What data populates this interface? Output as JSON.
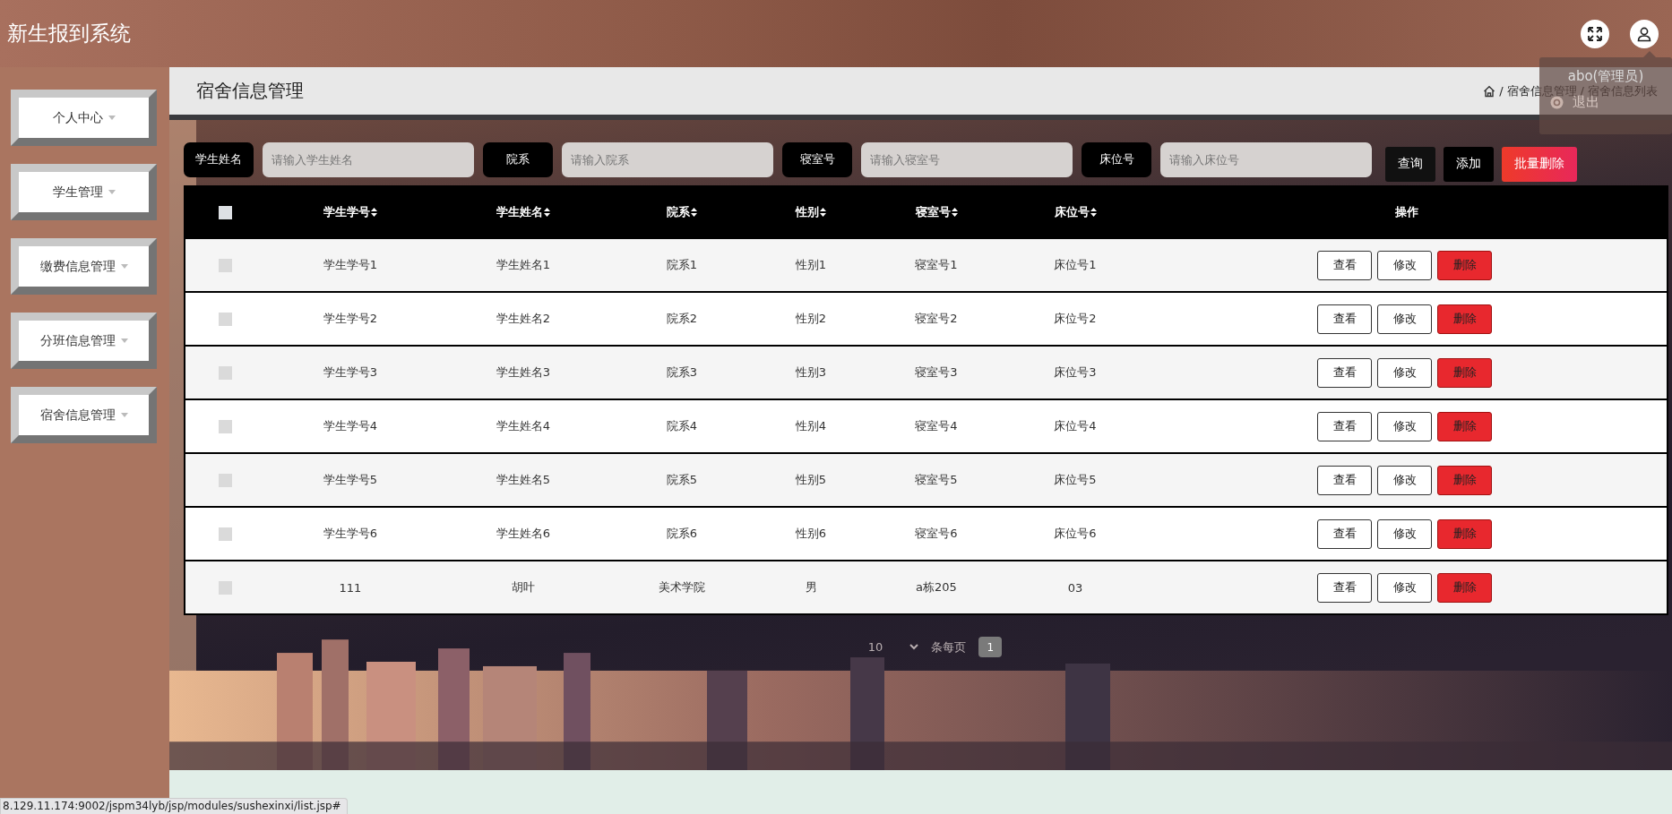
{
  "app": {
    "title": "新生报到系统"
  },
  "user_menu": {
    "user": "abo(管理员)",
    "logout": "退出"
  },
  "sidebar": {
    "items": [
      {
        "label": "个人中心"
      },
      {
        "label": "学生管理"
      },
      {
        "label": "缴费信息管理"
      },
      {
        "label": "分班信息管理"
      },
      {
        "label": "宿舍信息管理"
      }
    ]
  },
  "page": {
    "title": "宿舍信息管理",
    "breadcrumb_separator": "/",
    "breadcrumb": [
      "宿舍信息管理",
      "宿舍信息列表"
    ]
  },
  "search": {
    "fields": [
      {
        "label": "学生姓名",
        "placeholder": "请输入学生姓名"
      },
      {
        "label": "院系",
        "placeholder": "请输入院系"
      },
      {
        "label": "寝室号",
        "placeholder": "请输入寝室号"
      },
      {
        "label": "床位号",
        "placeholder": "请输入床位号"
      }
    ],
    "buttons": [
      {
        "label": "查询",
        "kind": "query"
      },
      {
        "label": "添加",
        "kind": "add"
      },
      {
        "label": "批量删除",
        "kind": "danger"
      }
    ]
  },
  "table": {
    "all_checked": false,
    "columns": [
      {
        "label": "学生学号",
        "sortable": true
      },
      {
        "label": "学生姓名",
        "sortable": true
      },
      {
        "label": "院系",
        "sortable": true
      },
      {
        "label": "性别",
        "sortable": true
      },
      {
        "label": "寝室号",
        "sortable": true
      },
      {
        "label": "床位号",
        "sortable": true
      },
      {
        "label": "操作",
        "sortable": false
      }
    ],
    "rows": [
      {
        "checked": false,
        "cells": [
          "学生学号1",
          "学生姓名1",
          "院系1",
          "性别1",
          "寝室号1",
          "床位号1"
        ],
        "actions": [
          {
            "label": "查看",
            "kind": "plain"
          },
          {
            "label": "修改",
            "kind": "plain"
          },
          {
            "label": "删除",
            "kind": "danger"
          }
        ]
      },
      {
        "checked": false,
        "cells": [
          "学生学号2",
          "学生姓名2",
          "院系2",
          "性别2",
          "寝室号2",
          "床位号2"
        ],
        "actions": [
          {
            "label": "查看",
            "kind": "plain"
          },
          {
            "label": "修改",
            "kind": "plain"
          },
          {
            "label": "删除",
            "kind": "danger"
          }
        ]
      },
      {
        "checked": false,
        "cells": [
          "学生学号3",
          "学生姓名3",
          "院系3",
          "性别3",
          "寝室号3",
          "床位号3"
        ],
        "actions": [
          {
            "label": "查看",
            "kind": "plain"
          },
          {
            "label": "修改",
            "kind": "plain"
          },
          {
            "label": "删除",
            "kind": "danger"
          }
        ]
      },
      {
        "checked": false,
        "cells": [
          "学生学号4",
          "学生姓名4",
          "院系4",
          "性别4",
          "寝室号4",
          "床位号4"
        ],
        "actions": [
          {
            "label": "查看",
            "kind": "plain"
          },
          {
            "label": "修改",
            "kind": "plain"
          },
          {
            "label": "删除",
            "kind": "danger"
          }
        ]
      },
      {
        "checked": false,
        "cells": [
          "学生学号5",
          "学生姓名5",
          "院系5",
          "性别5",
          "寝室号5",
          "床位号5"
        ],
        "actions": [
          {
            "label": "查看",
            "kind": "plain"
          },
          {
            "label": "修改",
            "kind": "plain"
          },
          {
            "label": "删除",
            "kind": "danger"
          }
        ]
      },
      {
        "checked": false,
        "cells": [
          "学生学号6",
          "学生姓名6",
          "院系6",
          "性别6",
          "寝室号6",
          "床位号6"
        ],
        "actions": [
          {
            "label": "查看",
            "kind": "plain"
          },
          {
            "label": "修改",
            "kind": "plain"
          },
          {
            "label": "删除",
            "kind": "danger"
          }
        ]
      },
      {
        "checked": false,
        "cells": [
          "111",
          "胡叶",
          "美术学院",
          "男",
          "a栋205",
          "03"
        ],
        "actions": [
          {
            "label": "查看",
            "kind": "plain"
          },
          {
            "label": "修改",
            "kind": "plain"
          },
          {
            "label": "删除",
            "kind": "danger"
          }
        ]
      }
    ]
  },
  "pagination": {
    "page_size": "10",
    "page_size_unit": "条每页",
    "pages": [
      {
        "label": "1",
        "selected": true
      }
    ]
  },
  "status_url": "8.129.11.174:9002/jspm34lyb/jsp/modules/sushexinxi/list.jsp#"
}
